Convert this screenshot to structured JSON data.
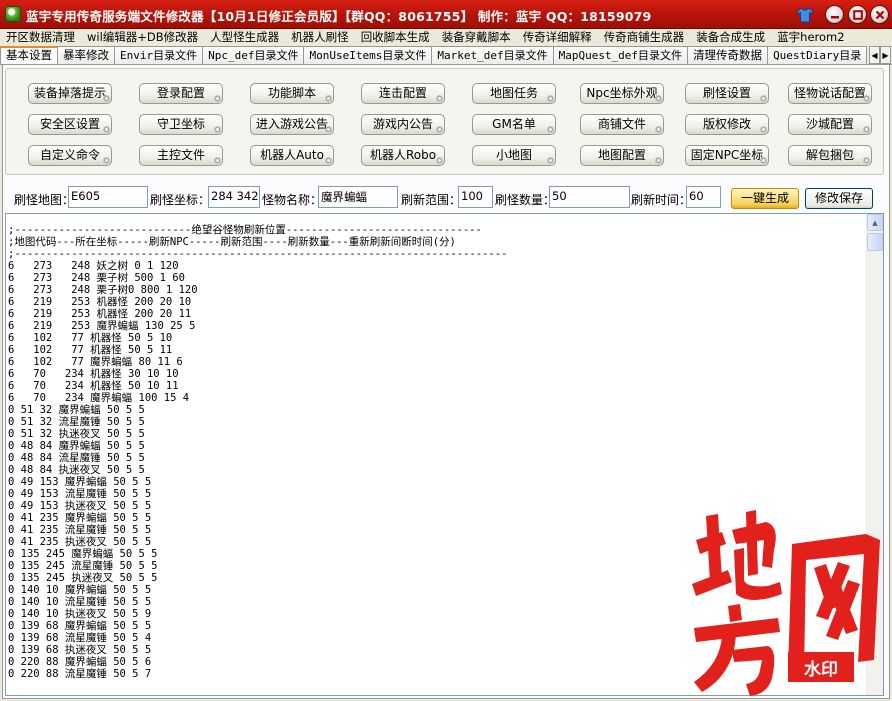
{
  "window": {
    "title": "蓝宇专用传奇服务端文件修改器【10月1日修正会员版】【群QQ：8061755】 制作：蓝宇 QQ：18159079",
    "controls": [
      "minimize",
      "maximize",
      "close"
    ]
  },
  "menu": [
    "开区数据清理",
    "wil编辑器+DB修改器",
    "人型怪生成器",
    "机器人刷怪",
    "回收脚本生成",
    "装备穿戴脚本",
    "传奇详细解释",
    "传奇商铺生成器",
    "装备合成生成",
    "蓝宇herom2"
  ],
  "tabs": [
    "基本设置",
    "暴率修改",
    "Envir目录文件",
    "Npc_def目录文件",
    "MonUseItems目录文件",
    "Market_def目录文件",
    "MapQuest_def目录文件",
    "清理传奇数据",
    "QuestDiary目录"
  ],
  "function_buttons": [
    [
      "装备掉落提示",
      "登录配置",
      "功能脚本",
      "连击配置",
      "地图任务",
      "Npc坐标外观",
      "刷怪设置",
      "怪物说话配置"
    ],
    [
      "安全区设置",
      "守卫坐标",
      "进入游戏公告",
      "游戏内公告",
      "GM名单",
      "商铺文件",
      "版权修改",
      "沙城配置"
    ],
    [
      "自定义命令",
      "主控文件",
      "机器人Auto",
      "机器人Robo",
      "小地图",
      "地图配置",
      "固定NPC坐标",
      "解包捆包"
    ]
  ],
  "params": {
    "map_label": "刷怪地图：",
    "map_value": "E605",
    "coord_label": "刷怪坐标：",
    "coord_value": "284 342",
    "monster_label": "怪物名称：",
    "monster_value": "魔界蝙蝠",
    "range_label": "刷新范围：",
    "range_value": "100",
    "count_label": "刷怪数量：",
    "count_value": "50",
    "time_label": "刷新时间：",
    "time_value": "60",
    "generate_button": "一键生成",
    "save_button": "修改保存"
  },
  "text_lines": [
    ";----------------------------绝望谷怪物刷新位置-------------------------------",
    ";地图代码---所在坐标-----刷新NPC-----刷新范围----刷新数量---重新刷新间断时间(分)",
    ";------------------------------------------------------------------------------",
    "6   273   248 妖之树 0 1 120",
    "6   273   248 栗子树 500 1 60",
    "6   273   248 栗子树0 800 1 120",
    "6   219   253 机器怪 200 20 10",
    "6   219   253 机器怪 200 20 11",
    "6   219   253 魔界蝙蝠 130 25 5",
    "6   102   77 机器怪 50 5 10",
    "6   102   77 机器怪 50 5 11",
    "6   102   77 魔界蝙蝠 80 11 6",
    "6   70   234 机器怪 30 10 10",
    "6   70   234 机器怪 50 10 11",
    "6   70   234 魔界蝙蝠 100 15 4",
    "0 51 32 魔界蝙蝠 50 5 5",
    "0 51 32 流星魔锤 50 5 5",
    "0 51 32 执迷夜叉 50 5 5",
    "0 48 84 魔界蝙蝠 50 5 5",
    "0 48 84 流星魔锤 50 5 5",
    "0 48 84 执迷夜叉 50 5 5",
    "0 49 153 魔界蝙蝠 50 5 5",
    "0 49 153 流星魔锤 50 5 5",
    "0 49 153 执迷夜叉 50 5 5",
    "0 41 235 魔界蝙蝠 50 5 5",
    "0 41 235 流星魔锤 50 5 5",
    "0 41 235 执迷夜叉 50 5 5",
    "0 135 245 魔界蝙蝠 50 5 5",
    "0 135 245 流星魔锤 50 5 5",
    "0 135 245 执迷夜叉 50 5 5",
    "0 140 10 魔界蝙蝠 50 5 5",
    "0 140 10 流星魔锤 50 5 5",
    "0 140 10 执迷夜叉 50 5 9",
    "0 139 68 魔界蝙蝠 50 5 5",
    "0 139 68 流星魔锤 50 5 4",
    "0 139 68 执迷夜叉 50 5 5",
    "0 220 88 魔界蝙蝠 50 5 6",
    "0 220 88 流星魔锤 50 5 7"
  ],
  "watermark": {
    "text": "地方网",
    "badge": "水印"
  },
  "colors": {
    "titlebar": "#c4170c",
    "window_bg": "#ece9d8",
    "active_tab_accent": "#e68b2c",
    "watermark_red": "#e2201c"
  }
}
